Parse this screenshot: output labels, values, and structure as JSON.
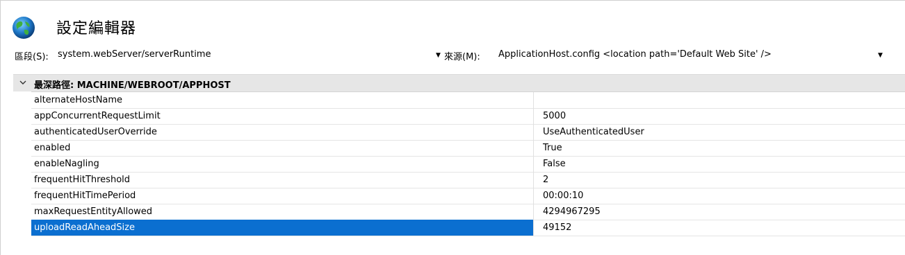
{
  "header": {
    "title": "設定編輯器",
    "icon": "globe-icon"
  },
  "toolbar": {
    "section_label": "區段(S):",
    "section_value": "system.webServer/serverRuntime",
    "source_label": "來源(M):",
    "source_value": "ApplicationHost.config <location path='Default Web Site' />"
  },
  "grid": {
    "group_label": "最深路徑: MACHINE/WEBROOT/APPHOST",
    "rows": [
      {
        "name": "alternateHostName",
        "value": ""
      },
      {
        "name": "appConcurrentRequestLimit",
        "value": "5000"
      },
      {
        "name": "authenticatedUserOverride",
        "value": "UseAuthenticatedUser"
      },
      {
        "name": "enabled",
        "value": "True"
      },
      {
        "name": "enableNagling",
        "value": "False"
      },
      {
        "name": "frequentHitThreshold",
        "value": "2"
      },
      {
        "name": "frequentHitTimePeriod",
        "value": "00:00:10"
      },
      {
        "name": "maxRequestEntityAllowed",
        "value": "4294967295"
      },
      {
        "name": "uploadReadAheadSize",
        "value": "49152"
      }
    ],
    "selected_row": "uploadReadAheadSize"
  },
  "colors": {
    "selection": "#0b6fd0",
    "group_bg": "#e6e6e6"
  }
}
